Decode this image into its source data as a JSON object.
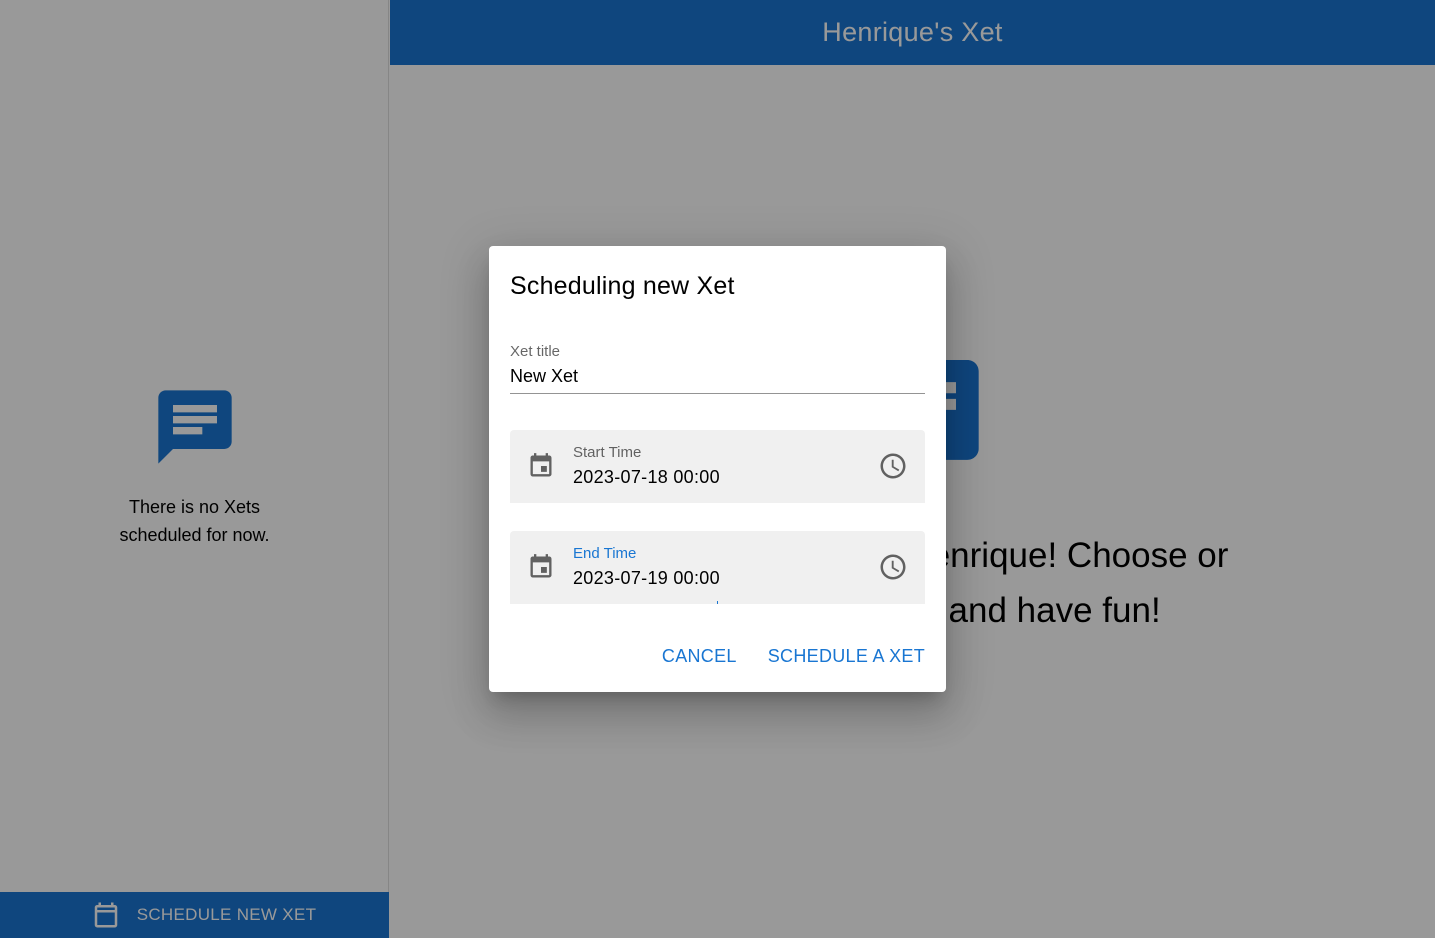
{
  "app": {
    "header_title": "Henrique's Xet"
  },
  "sidebar": {
    "empty_message": "There is no Xets scheduled for now.",
    "schedule_button_label": "SCHEDULE NEW XET"
  },
  "main": {
    "welcome_text": "Welcome to Henrique! Choose or start a Xet and have fun!"
  },
  "dialog": {
    "title": "Scheduling new Xet",
    "title_field": {
      "label": "Xet title",
      "value": "New Xet"
    },
    "start_time": {
      "label": "Start Time",
      "value": "2023-07-18 00:00"
    },
    "end_time": {
      "label": "End Time",
      "value": "2023-07-19 00:00"
    },
    "cancel_label": "CANCEL",
    "submit_label": "SCHEDULE A XET"
  },
  "colors": {
    "primary": "#1976d2",
    "backdrop": "rgba(0,0,0,0.40)"
  },
  "icons": [
    "chat-bubble-icon",
    "calendar-icon",
    "clock-icon"
  ]
}
